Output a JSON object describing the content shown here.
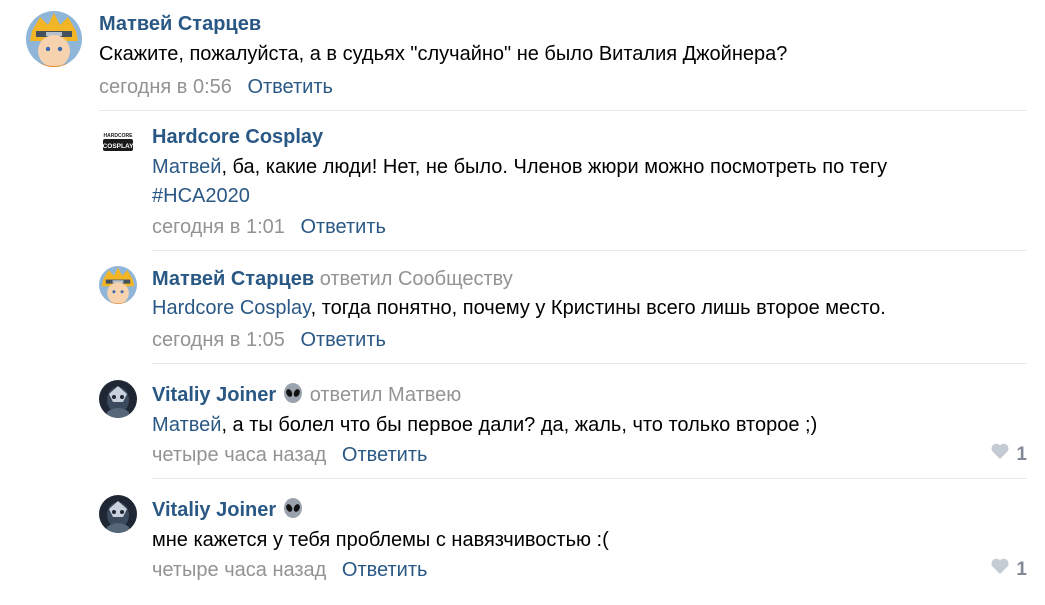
{
  "comments": [
    {
      "author": "Матвей Старцев",
      "text": "Скажите, пожалуйста, а в судьях \"случайно\" не было Виталия Джойнера?",
      "date": "сегодня в 0:56",
      "reply_label": "Ответить"
    },
    {
      "author": "Hardcore Cosplay",
      "mention": "Матвей",
      "text": ", ба, какие люди! Нет, не было. Членов жюри можно посмотреть по тегу",
      "hashtag": "#HCA2020",
      "date": "сегодня в 1:01",
      "reply_label": "Ответить"
    },
    {
      "author": "Матвей Старцев",
      "replied_to": "ответил Сообществу",
      "mention": "Hardcore Cosplay",
      "text": ", тогда понятно, почему у Кристины всего лишь второе место.",
      "date": "сегодня в 1:05",
      "reply_label": "Ответить"
    },
    {
      "author": "Vitaliy Joiner",
      "replied_to": "ответил Матвею",
      "mention": "Матвей",
      "text": ", а ты болел что бы первое дали? да, жаль, что только второе ;)",
      "date": "четыре часа назад",
      "reply_label": "Ответить",
      "likes": "1"
    },
    {
      "author": "Vitaliy Joiner",
      "text": "мне кажется у тебя проблемы с навязчивостью :(",
      "date": "четыре часа назад",
      "reply_label": "Ответить",
      "likes": "1"
    }
  ],
  "avatar_logo_text": [
    "HARDCORE",
    "COSPLAY"
  ],
  "colors": {
    "link": "#2a5885",
    "muted": "#939393",
    "divider": "#e7e8ec",
    "like": "#828a99"
  },
  "icons": {
    "alien": "alien-emoji-icon",
    "heart": "heart-icon"
  }
}
